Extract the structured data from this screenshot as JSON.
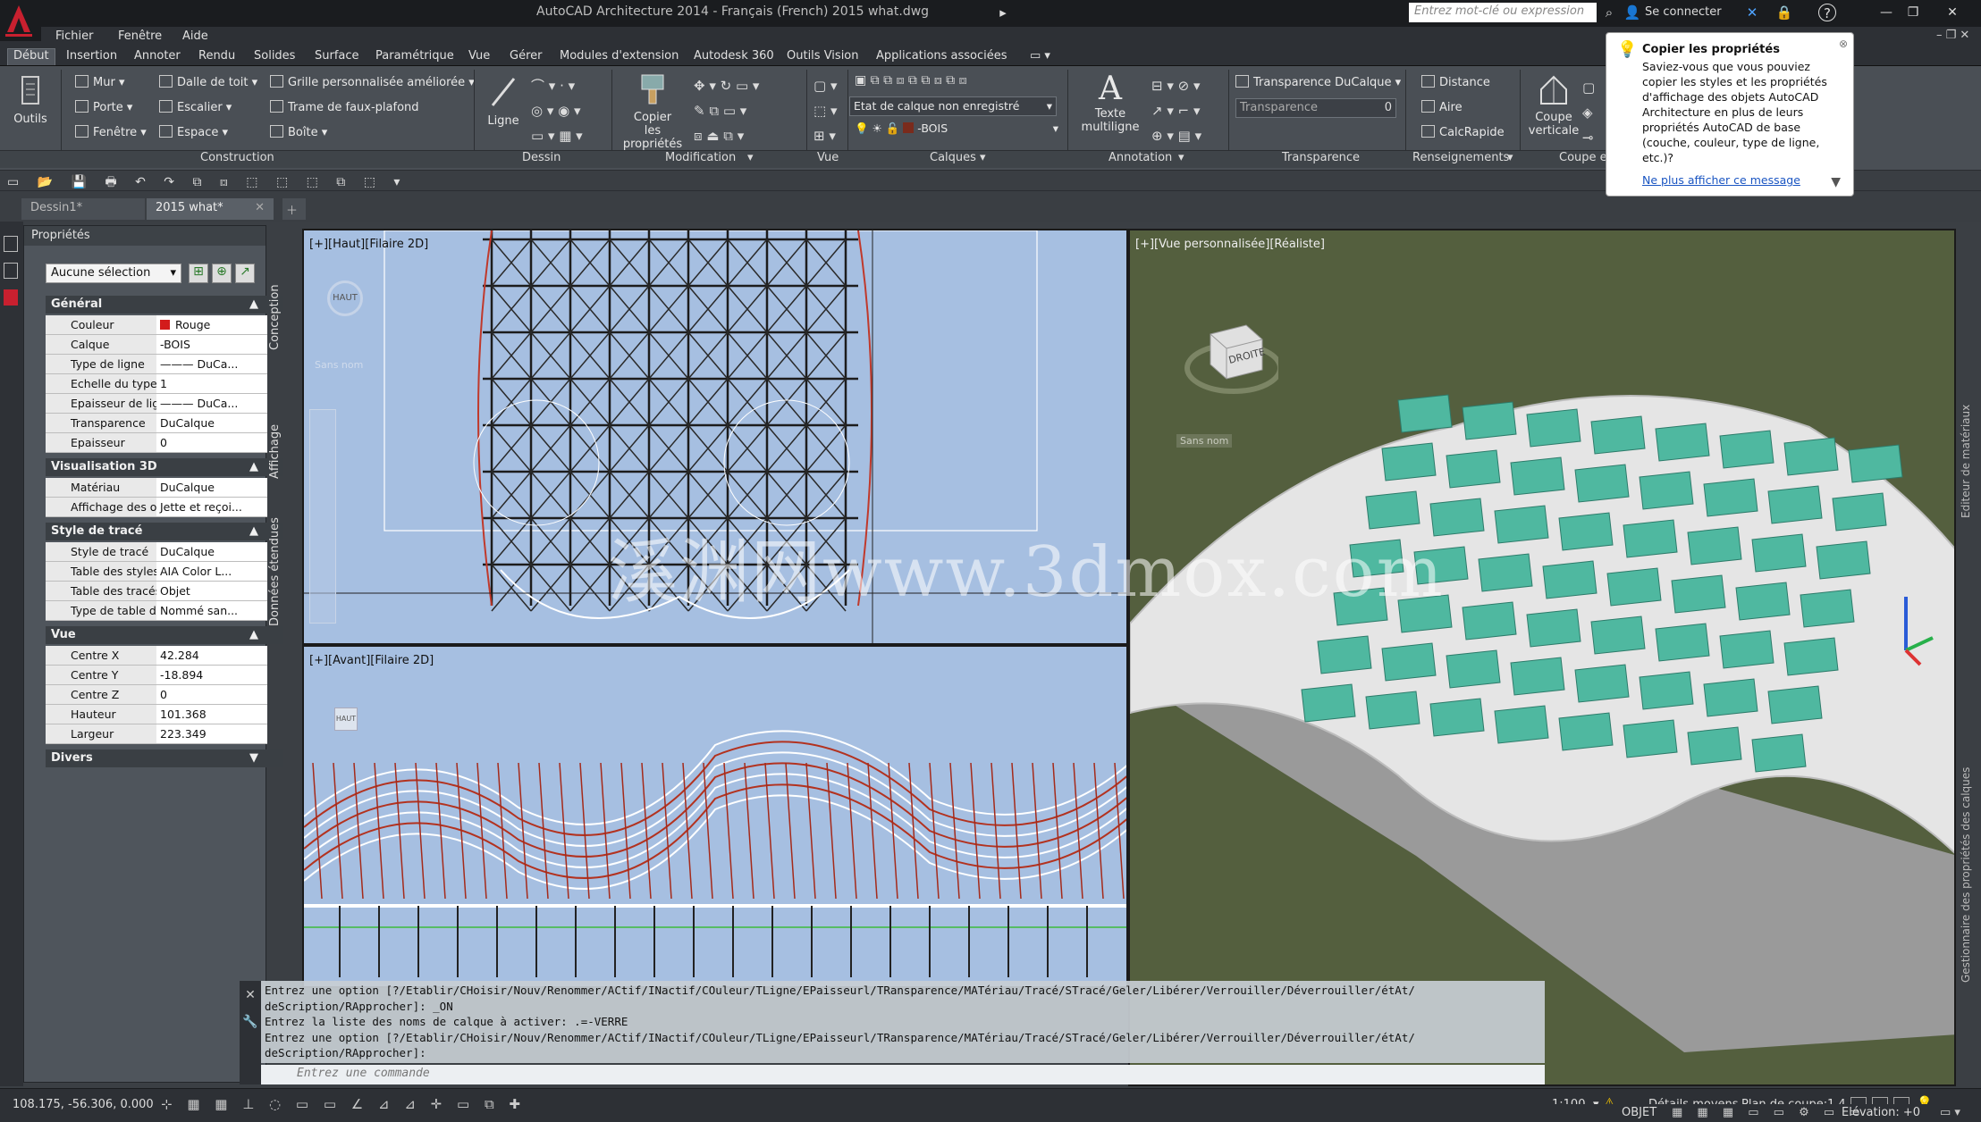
{
  "title": "AutoCAD Architecture 2014 - Français (French)   2015 what.dwg",
  "search_placeholder": "Entrez mot-clé ou expression",
  "signin": "Se connecter",
  "menu": [
    "Fichier",
    "Fenêtre",
    "Aide"
  ],
  "ribbon_tabs": [
    "Début",
    "Insertion",
    "Annoter",
    "Rendu",
    "Solides",
    "Surface",
    "Paramétrique",
    "Vue",
    "Gérer",
    "Modules d'extension",
    "Autodesk 360",
    "Outils Vision",
    "Applications associées"
  ],
  "ribbon": {
    "outils": "Outils",
    "construction": {
      "title": "Construction",
      "mur": "Mur",
      "porte": "Porte",
      "fenetre": "Fenêtre",
      "dalle": "Dalle de toit",
      "escalier": "Escalier",
      "espace": "Espace",
      "grille": "Grille personnalisée améliorée",
      "trame": "Trame de faux-plafond",
      "boite": "Boîte"
    },
    "dessin": {
      "title": "Dessin",
      "ligne": "Ligne"
    },
    "modification": {
      "title": "Modification",
      "copier1": "Copier",
      "copier2": "les propriétés"
    },
    "vue": {
      "title": "Vue"
    },
    "calques": {
      "title": "Calques",
      "state": "Etat de calque non enregistré",
      "layer": "-BOIS"
    },
    "annotation": {
      "title": "Annotation",
      "texte1": "Texte",
      "texte2": "multiligne"
    },
    "transparence": {
      "title": "Transparence",
      "dd": "Transparence DuCalque",
      "label": "Transparence",
      "value": "0"
    },
    "renseignements": {
      "title": "Renseignements",
      "distance": "Distance",
      "aire": "Aire",
      "calc": "CalcRapide"
    },
    "coupe": {
      "title": "Coupe e",
      "b1": "Coupe",
      "b2": "verticale"
    }
  },
  "file_tabs": [
    "Dessin1*",
    "2015 what*"
  ],
  "tooltip": {
    "title": "Copier les propriétés",
    "body": "Saviez-vous que vous pouviez copier les styles et les propriétés d'affichage des objets AutoCAD Architecture en plus de leurs propriétés AutoCAD de base (couche, couleur, type de ligne, etc.)?",
    "link": "Ne plus afficher ce message"
  },
  "properties": {
    "title": "Propriétés",
    "selection": "Aucune sélection",
    "vtabs": [
      "Conception",
      "Affichage",
      "Données étendues"
    ],
    "sections": [
      {
        "name": "Général",
        "rows": [
          {
            "k": "Couleur",
            "v": "Rouge"
          },
          {
            "k": "Calque",
            "v": "-BOIS"
          },
          {
            "k": "Type de ligne",
            "v": "——— DuCa..."
          },
          {
            "k": "Echelle du type de ...",
            "v": "1"
          },
          {
            "k": "Epaisseur de ligne",
            "v": "——— DuCa..."
          },
          {
            "k": "Transparence",
            "v": "DuCalque"
          },
          {
            "k": "Epaisseur",
            "v": "0"
          }
        ]
      },
      {
        "name": "Visualisation 3D",
        "rows": [
          {
            "k": "Matériau",
            "v": "DuCalque"
          },
          {
            "k": "Affichage des omb...",
            "v": "Jette et reçoi..."
          }
        ]
      },
      {
        "name": "Style de tracé",
        "rows": [
          {
            "k": "Style de tracé",
            "v": "DuCalque"
          },
          {
            "k": "Table des styles de ...",
            "v": "AIA Color L..."
          },
          {
            "k": "Table des tracés att...",
            "v": "Objet"
          },
          {
            "k": "Type de table de tr...",
            "v": "Nommé san..."
          }
        ]
      },
      {
        "name": "Vue",
        "rows": [
          {
            "k": "Centre X",
            "v": "42.284"
          },
          {
            "k": "Centre Y",
            "v": "-18.894"
          },
          {
            "k": "Centre Z",
            "v": "0"
          },
          {
            "k": "Hauteur",
            "v": "101.368"
          },
          {
            "k": "Largeur",
            "v": "223.349"
          }
        ]
      },
      {
        "name": "Divers",
        "rows": []
      }
    ]
  },
  "viewports": {
    "top": "[+][Haut][Filaire 2D]",
    "front": "[+][Avant][Filaire 2D]",
    "persp": "[+][Vue personnalisée][Réaliste]",
    "cube_haut": "HAUT",
    "cube_droite": "DROITE",
    "sans_nom": "Sans nom"
  },
  "right_tabs": [
    "Editeur de matériaux",
    "Gestionnaire des propriétés des calques"
  ],
  "command": {
    "history": [
      "Entrez une option [?/Etablir/CHoisir/Nouv/Renommer/ACtif/INactif/COuleur/TLigne/EPaisseurl/TRansparence/MATériau/Tracé/STracé/Geler/Libérer/Verrouiller/Déverrouiller/étAt/",
      "deScription/RApprocher]: _ON",
      "Entrez la liste des noms de calque à activer: .=-VERRE",
      "Entrez une option [?/Etablir/CHoisir/Nouv/Renommer/ACtif/INactif/COuleur/TLigne/EPaisseurl/TRansparence/MATériau/Tracé/STracé/Geler/Libérer/Verrouiller/Déverrouiller/étAt/",
      "deScription/RApprocher]:"
    ],
    "placeholder": "Entrez une commande"
  },
  "status": {
    "coords": "108.175, -56.306, 0.000",
    "scale": "1:100",
    "details": "Détails moyens",
    "cut_label": "Plan de coupe:",
    "cut_value": "1.4",
    "objet": "OBJET",
    "elevation": "Elévation: +0"
  },
  "watermark": "溪渊网www.3dmox.com",
  "colors": {
    "accent": "#c8202f",
    "viewport_bg": "#a6bfe1",
    "ground": "#545f3e",
    "glass": "#4fb8a0"
  }
}
